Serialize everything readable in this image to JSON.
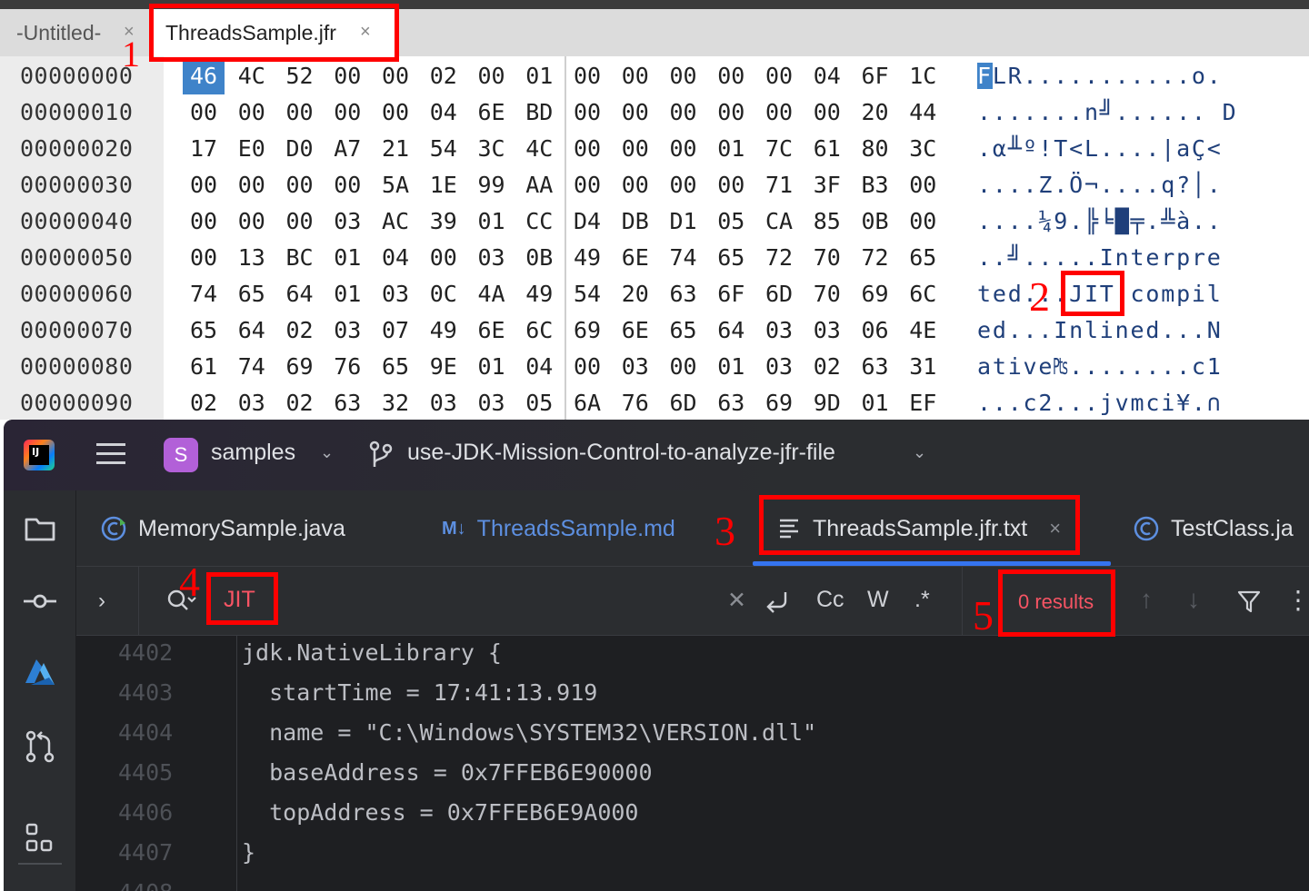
{
  "hex_editor": {
    "tabs": [
      {
        "label": "-Untitled-",
        "close": "×"
      },
      {
        "label": "ThreadsSample.jfr",
        "close": "×"
      }
    ],
    "rows": [
      {
        "offset": "00000000",
        "bytes": [
          "46",
          "4C",
          "52",
          "00",
          "00",
          "02",
          "00",
          "01",
          "00",
          "00",
          "00",
          "00",
          "00",
          "04",
          "6F",
          "1C"
        ],
        "ascii_selected": "F",
        "ascii": "LR...........o."
      },
      {
        "offset": "00000010",
        "bytes": [
          "00",
          "00",
          "00",
          "00",
          "00",
          "04",
          "6E",
          "BD",
          "00",
          "00",
          "00",
          "00",
          "00",
          "00",
          "20",
          "44"
        ],
        "ascii_selected": "",
        "ascii": ".......n╝...... D"
      },
      {
        "offset": "00000020",
        "bytes": [
          "17",
          "E0",
          "D0",
          "A7",
          "21",
          "54",
          "3C",
          "4C",
          "00",
          "00",
          "00",
          "01",
          "7C",
          "61",
          "80",
          "3C"
        ],
        "ascii_selected": "",
        "ascii": ".α╨º!T<L....|aÇ<"
      },
      {
        "offset": "00000030",
        "bytes": [
          "00",
          "00",
          "00",
          "00",
          "5A",
          "1E",
          "99",
          "AA",
          "00",
          "00",
          "00",
          "00",
          "71",
          "3F",
          "B3",
          "00"
        ],
        "ascii_selected": "",
        "ascii": "....Z.Ö¬....q?│."
      },
      {
        "offset": "00000040",
        "bytes": [
          "00",
          "00",
          "00",
          "03",
          "AC",
          "39",
          "01",
          "CC",
          "D4",
          "DB",
          "D1",
          "05",
          "CA",
          "85",
          "0B",
          "00"
        ],
        "ascii_selected": "",
        "ascii": "....¼9.╠╘█╤.╩à.."
      },
      {
        "offset": "00000050",
        "bytes": [
          "00",
          "13",
          "BC",
          "01",
          "04",
          "00",
          "03",
          "0B",
          "49",
          "6E",
          "74",
          "65",
          "72",
          "70",
          "72",
          "65"
        ],
        "ascii_selected": "",
        "ascii": "..╝.....Interpre"
      },
      {
        "offset": "00000060",
        "bytes": [
          "74",
          "65",
          "64",
          "01",
          "03",
          "0C",
          "4A",
          "49",
          "54",
          "20",
          "63",
          "6F",
          "6D",
          "70",
          "69",
          "6C"
        ],
        "ascii_selected": "",
        "ascii": "ted...JIT compil"
      },
      {
        "offset": "00000070",
        "bytes": [
          "65",
          "64",
          "02",
          "03",
          "07",
          "49",
          "6E",
          "6C",
          "69",
          "6E",
          "65",
          "64",
          "03",
          "03",
          "06",
          "4E"
        ],
        "ascii_selected": "",
        "ascii": "ed...Inlined...N"
      },
      {
        "offset": "00000080",
        "bytes": [
          "61",
          "74",
          "69",
          "76",
          "65",
          "9E",
          "01",
          "04",
          "00",
          "03",
          "00",
          "01",
          "03",
          "02",
          "63",
          "31"
        ],
        "ascii_selected": "",
        "ascii": "ative₧........c1"
      },
      {
        "offset": "00000090",
        "bytes": [
          "02",
          "03",
          "02",
          "63",
          "32",
          "03",
          "03",
          "05",
          "6A",
          "76",
          "6D",
          "63",
          "69",
          "9D",
          "01",
          "EF"
        ],
        "ascii_selected": "",
        "ascii": "...c2...jvmci¥.∩"
      }
    ]
  },
  "ide": {
    "logo": "IJ",
    "project": {
      "badge": "S",
      "name": "samples"
    },
    "branch": "use-JDK-Mission-Control-to-analyze-jfr-file",
    "tabs": [
      {
        "label": "MemorySample.java",
        "icon": "java-class-icon"
      },
      {
        "label": "ThreadsSample.md",
        "icon": "markdown-icon",
        "icon_text": "M↓"
      },
      {
        "label": "ThreadsSample.jfr.txt",
        "icon": "text-file-icon",
        "close": "×"
      },
      {
        "label": "TestClass.ja",
        "icon": "class-icon"
      }
    ],
    "search": {
      "query": "JIT",
      "match_case": "Cc",
      "words": "W",
      "regex": ".*",
      "results": "0 results"
    },
    "code_lines": [
      {
        "num": "4402",
        "text": "jdk.NativeLibrary {"
      },
      {
        "num": "4403",
        "text": "  startTime = 17:41:13.919"
      },
      {
        "num": "4404",
        "text": "  name = \"C:\\Windows\\SYSTEM32\\VERSION.dll\""
      },
      {
        "num": "4405",
        "text": "  baseAddress = 0x7FFEB6E90000"
      },
      {
        "num": "4406",
        "text": "  topAddress = 0x7FFEB6E9A000"
      },
      {
        "num": "4407",
        "text": "}"
      },
      {
        "num": "4408",
        "text": ""
      }
    ]
  },
  "annotations": [
    "1",
    "2",
    "3",
    "4",
    "5"
  ],
  "colors": {
    "annotation": "#ff0000",
    "hex_selection": "#3f83c9",
    "search_highlight": "#f75464",
    "ide_accent": "#3574f0"
  }
}
